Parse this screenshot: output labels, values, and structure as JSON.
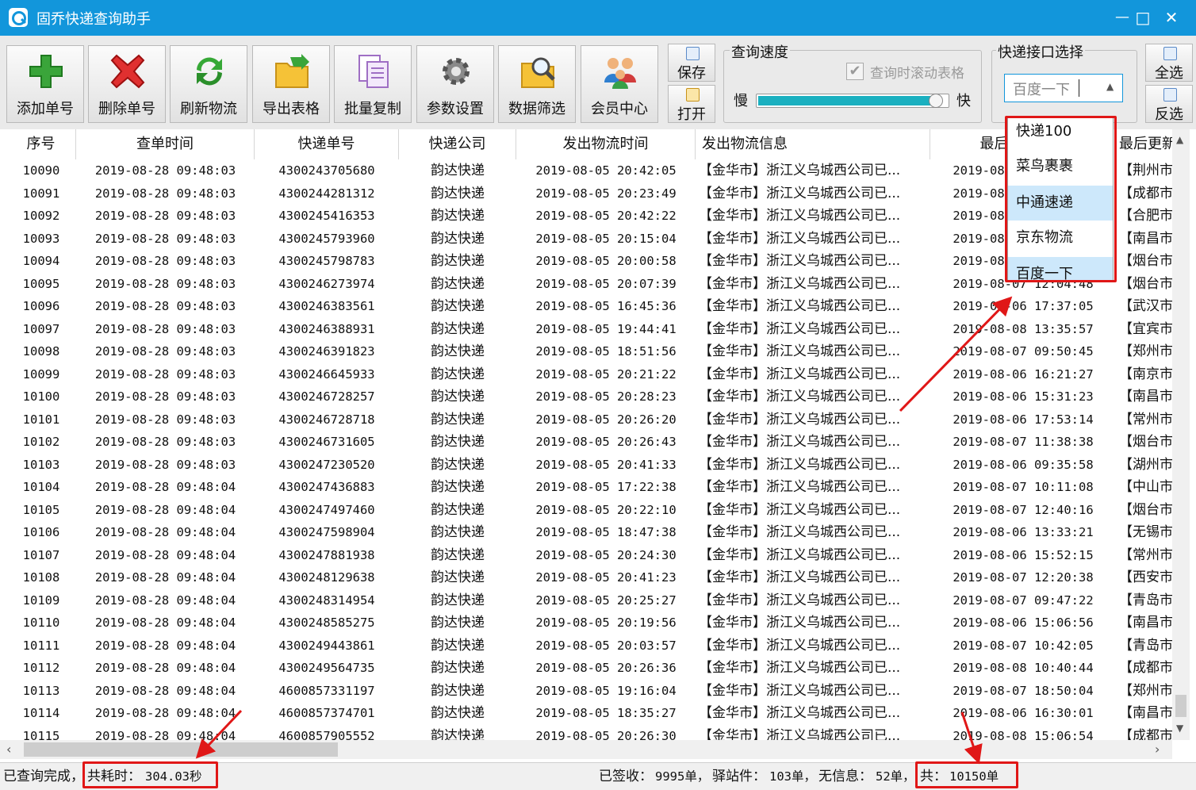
{
  "window": {
    "title": "固乔快递查询助手",
    "minimize": "—",
    "maximize": "□",
    "close": "✕"
  },
  "toolbar": {
    "buttons": [
      {
        "label": "添加单号",
        "icon": "add-icon"
      },
      {
        "label": "删除单号",
        "icon": "delete-icon"
      },
      {
        "label": "刷新物流",
        "icon": "refresh-icon"
      },
      {
        "label": "导出表格",
        "icon": "export-icon"
      },
      {
        "label": "批量复制",
        "icon": "copy-icon"
      },
      {
        "label": "参数设置",
        "icon": "gear-icon"
      },
      {
        "label": "数据筛选",
        "icon": "filter-icon"
      },
      {
        "label": "会员中心",
        "icon": "member-icon"
      }
    ],
    "save_label": "保存",
    "open_label": "打开",
    "select_all_label": "全选",
    "invert_label": "反选"
  },
  "speed": {
    "title": "查询速度",
    "scroll_label": "查询时滚动表格",
    "slow": "慢",
    "fast": "快",
    "level": 0.78
  },
  "api": {
    "title": "快递接口选择",
    "selected": "百度一下",
    "options": [
      "快递100",
      "菜鸟裹裹",
      "中通速递",
      "京东物流",
      "百度一下"
    ]
  },
  "table": {
    "headers": [
      "序号",
      "查单时间",
      "快递单号",
      "快递公司",
      "发出物流时间",
      "发出物流信息",
      "最后更新时间",
      "最后更新"
    ],
    "rows": [
      [
        "10090",
        "2019-08-28 09:48:03",
        "4300243705680",
        "韵达快递",
        "2019-08-05 20:42:05",
        "【金华市】浙江义乌城西公司已...",
        "2019-08-06 16:03:29",
        "【荆州市"
      ],
      [
        "10091",
        "2019-08-28 09:48:03",
        "4300244281312",
        "韵达快递",
        "2019-08-05 20:23:49",
        "【金华市】浙江义乌城西公司已...",
        "2019-08-07 10:15:42",
        "【成都市"
      ],
      [
        "10092",
        "2019-08-28 09:48:03",
        "4300245416353",
        "韵达快递",
        "2019-08-05 20:42:22",
        "【金华市】浙江义乌城西公司已...",
        "2019-08-06 16:20:20",
        "【合肥市"
      ],
      [
        "10093",
        "2019-08-28 09:48:03",
        "4300245793960",
        "韵达快递",
        "2019-08-05 20:15:04",
        "【金华市】浙江义乌城西公司已...",
        "2019-08-06 13:50:33",
        "【南昌市"
      ],
      [
        "10094",
        "2019-08-28 09:48:03",
        "4300245798783",
        "韵达快递",
        "2019-08-05 20:00:58",
        "【金华市】浙江义乌城西公司已...",
        "2019-08-07 11:20:16",
        "【烟台市"
      ],
      [
        "10095",
        "2019-08-28 09:48:03",
        "4300246273974",
        "韵达快递",
        "2019-08-05 20:07:39",
        "【金华市】浙江义乌城西公司已...",
        "2019-08-07 12:04:48",
        "【烟台市"
      ],
      [
        "10096",
        "2019-08-28 09:48:03",
        "4300246383561",
        "韵达快递",
        "2019-08-05 16:45:36",
        "【金华市】浙江义乌城西公司已...",
        "2019-08-06 17:37:05",
        "【武汉市"
      ],
      [
        "10097",
        "2019-08-28 09:48:03",
        "4300246388931",
        "韵达快递",
        "2019-08-05 19:44:41",
        "【金华市】浙江义乌城西公司已...",
        "2019-08-08 13:35:57",
        "【宜宾市"
      ],
      [
        "10098",
        "2019-08-28 09:48:03",
        "4300246391823",
        "韵达快递",
        "2019-08-05 18:51:56",
        "【金华市】浙江义乌城西公司已...",
        "2019-08-07 09:50:45",
        "【郑州市"
      ],
      [
        "10099",
        "2019-08-28 09:48:03",
        "4300246645933",
        "韵达快递",
        "2019-08-05 20:21:22",
        "【金华市】浙江义乌城西公司已...",
        "2019-08-06 16:21:27",
        "【南京市"
      ],
      [
        "10100",
        "2019-08-28 09:48:03",
        "4300246728257",
        "韵达快递",
        "2019-08-05 20:28:23",
        "【金华市】浙江义乌城西公司已...",
        "2019-08-06 15:31:23",
        "【南昌市"
      ],
      [
        "10101",
        "2019-08-28 09:48:03",
        "4300246728718",
        "韵达快递",
        "2019-08-05 20:26:20",
        "【金华市】浙江义乌城西公司已...",
        "2019-08-06 17:53:14",
        "【常州市"
      ],
      [
        "10102",
        "2019-08-28 09:48:03",
        "4300246731605",
        "韵达快递",
        "2019-08-05 20:26:43",
        "【金华市】浙江义乌城西公司已...",
        "2019-08-07 11:38:38",
        "【烟台市"
      ],
      [
        "10103",
        "2019-08-28 09:48:03",
        "4300247230520",
        "韵达快递",
        "2019-08-05 20:41:33",
        "【金华市】浙江义乌城西公司已...",
        "2019-08-06 09:35:58",
        "【湖州市"
      ],
      [
        "10104",
        "2019-08-28 09:48:04",
        "4300247436883",
        "韵达快递",
        "2019-08-05 17:22:38",
        "【金华市】浙江义乌城西公司已...",
        "2019-08-07 10:11:08",
        "【中山市"
      ],
      [
        "10105",
        "2019-08-28 09:48:04",
        "4300247497460",
        "韵达快递",
        "2019-08-05 20:22:10",
        "【金华市】浙江义乌城西公司已...",
        "2019-08-07 12:40:16",
        "【烟台市"
      ],
      [
        "10106",
        "2019-08-28 09:48:04",
        "4300247598904",
        "韵达快递",
        "2019-08-05 18:47:38",
        "【金华市】浙江义乌城西公司已...",
        "2019-08-06 13:33:21",
        "【无锡市"
      ],
      [
        "10107",
        "2019-08-28 09:48:04",
        "4300247881938",
        "韵达快递",
        "2019-08-05 20:24:30",
        "【金华市】浙江义乌城西公司已...",
        "2019-08-06 15:52:15",
        "【常州市"
      ],
      [
        "10108",
        "2019-08-28 09:48:04",
        "4300248129638",
        "韵达快递",
        "2019-08-05 20:41:23",
        "【金华市】浙江义乌城西公司已...",
        "2019-08-07 12:20:38",
        "【西安市"
      ],
      [
        "10109",
        "2019-08-28 09:48:04",
        "4300248314954",
        "韵达快递",
        "2019-08-05 20:25:27",
        "【金华市】浙江义乌城西公司已...",
        "2019-08-07 09:47:22",
        "【青岛市"
      ],
      [
        "10110",
        "2019-08-28 09:48:04",
        "4300248585275",
        "韵达快递",
        "2019-08-05 20:19:56",
        "【金华市】浙江义乌城西公司已...",
        "2019-08-06 15:06:56",
        "【南昌市"
      ],
      [
        "10111",
        "2019-08-28 09:48:04",
        "4300249443861",
        "韵达快递",
        "2019-08-05 20:03:57",
        "【金华市】浙江义乌城西公司已...",
        "2019-08-07 10:42:05",
        "【青岛市"
      ],
      [
        "10112",
        "2019-08-28 09:48:04",
        "4300249564735",
        "韵达快递",
        "2019-08-05 20:26:36",
        "【金华市】浙江义乌城西公司已...",
        "2019-08-08 10:40:44",
        "【成都市"
      ],
      [
        "10113",
        "2019-08-28 09:48:04",
        "4600857331197",
        "韵达快递",
        "2019-08-05 19:16:04",
        "【金华市】浙江义乌城西公司已...",
        "2019-08-07 18:50:04",
        "【郑州市"
      ],
      [
        "10114",
        "2019-08-28 09:48:04",
        "4600857374701",
        "韵达快递",
        "2019-08-05 18:35:27",
        "【金华市】浙江义乌城西公司已...",
        "2019-08-06 16:30:01",
        "【南昌市"
      ],
      [
        "10115",
        "2019-08-28 09:48:04",
        "4600857905552",
        "韵达快递",
        "2019-08-05 20:26:30",
        "【金华市】浙江义乌城西公司已...",
        "2019-08-08 15:06:54",
        "【成都市"
      ]
    ]
  },
  "status": {
    "done": "已查询完成，",
    "elapsed_label": "共耗时：",
    "elapsed_value": "304.03秒",
    "signed_label": "已签收：",
    "signed_value": "9995单，",
    "station_label": "驿站件：",
    "station_value": "103单，",
    "noinfo_label": "无信息：",
    "noinfo_value": "52单，",
    "total_label": "共：",
    "total_value": "10150单"
  },
  "colors": {
    "titlebar": "#1296db",
    "highlight": "#e01717",
    "selection": "#cde8fb",
    "slider": "#1ab0c0"
  }
}
